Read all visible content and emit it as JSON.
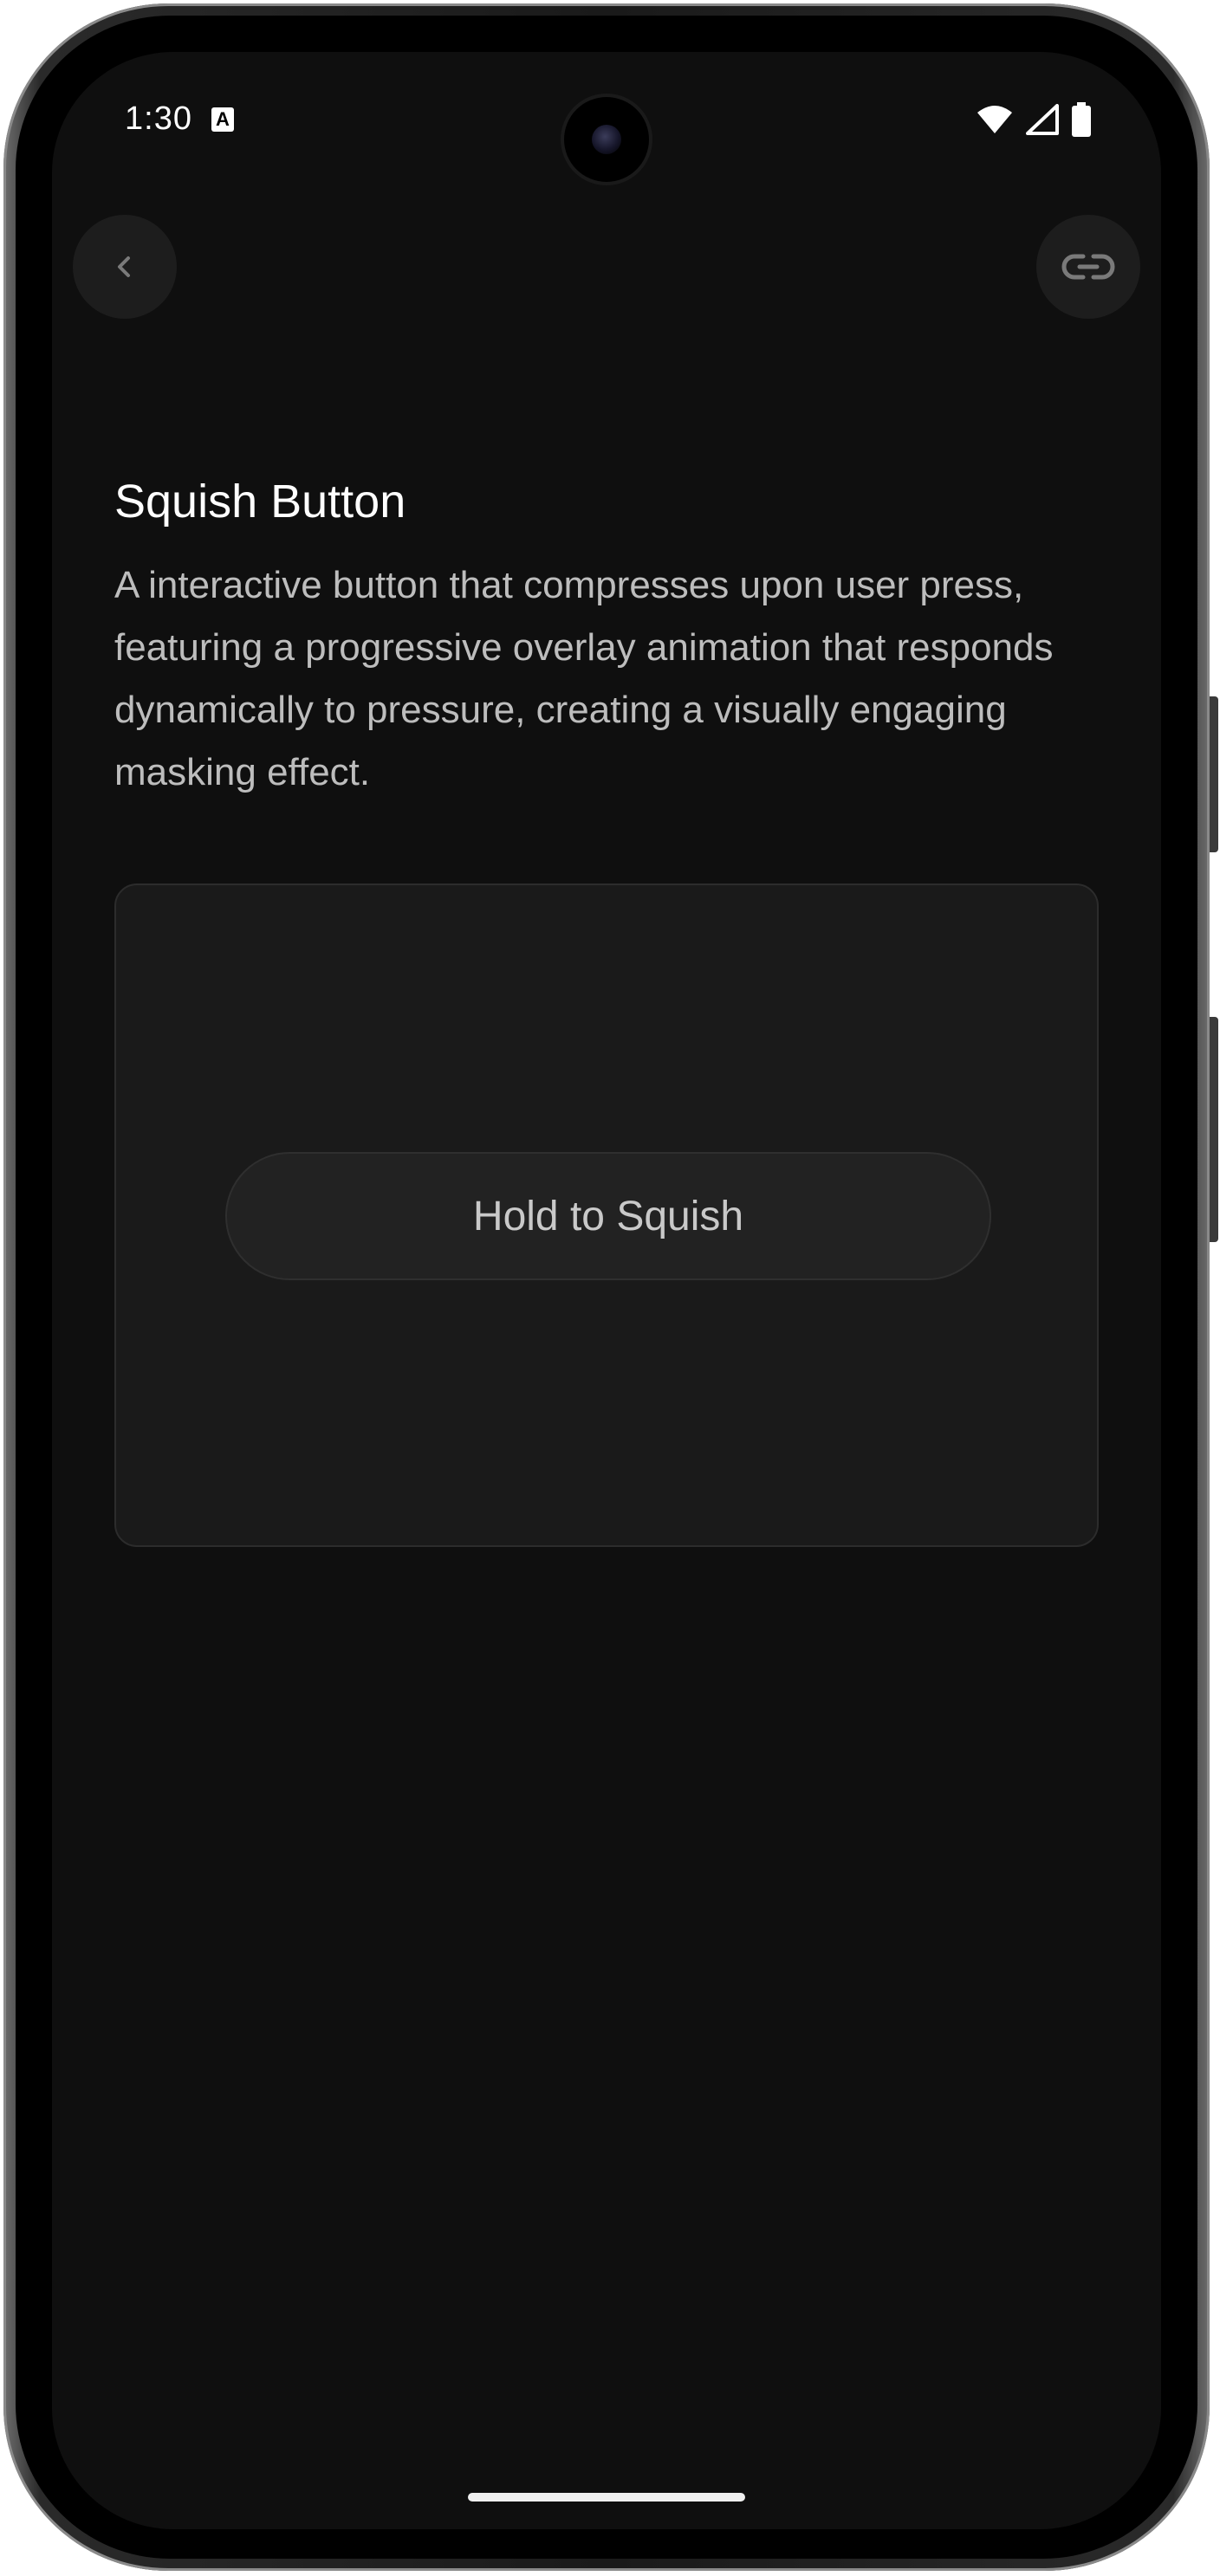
{
  "status_bar": {
    "time": "1:30",
    "notification_icon": "a-icon",
    "notification_label": "A",
    "icons": [
      "wifi-icon",
      "signal-icon",
      "battery-icon"
    ]
  },
  "header": {
    "back_icon": "chevron-left-icon",
    "link_icon": "link-icon"
  },
  "content": {
    "title": "Squish Button",
    "description": "A interactive button that compresses upon user press, featuring a progressive overlay animation that responds dynamically to pressure, creating a visually engaging masking effect."
  },
  "demo": {
    "button_label": "Hold to Squish"
  },
  "colors": {
    "background": "#0f0f0f",
    "card": "#1a1a1a",
    "button": "#222222",
    "text_primary": "#ffffff",
    "text_secondary": "#bdbdbd"
  }
}
